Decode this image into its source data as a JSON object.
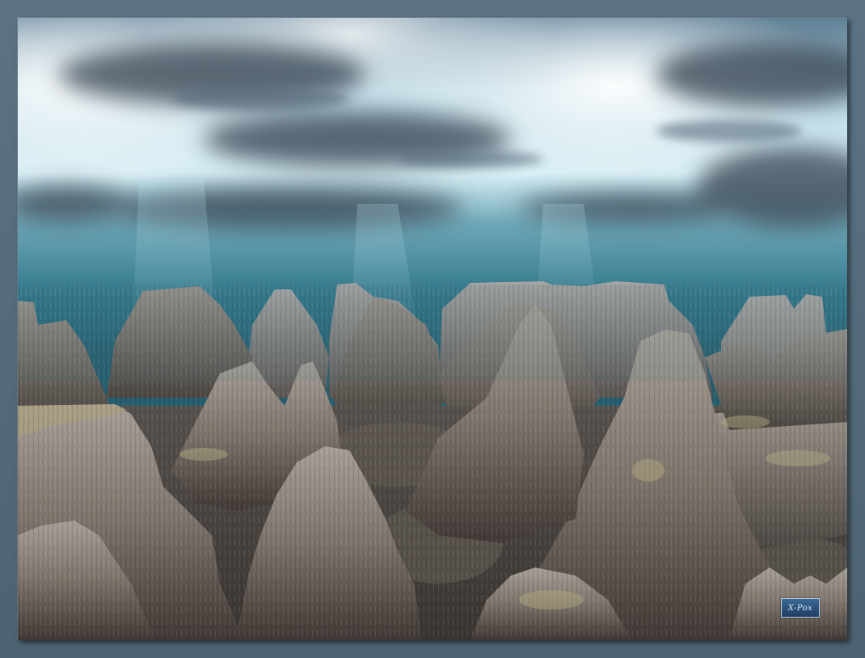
{
  "artwork": {
    "subject": "rocky-canyon-landscape",
    "watermark": {
      "text": "X-Pox"
    }
  },
  "colors": {
    "frame": "#4f6678",
    "sky_light": "#e9f6fa",
    "sky_teal": "#2d6d80",
    "cloud_dark": "#3c4a58",
    "rock_light": "#9e9a98",
    "rock_dark": "#4a4440",
    "valley_floor": "#4d4642"
  }
}
